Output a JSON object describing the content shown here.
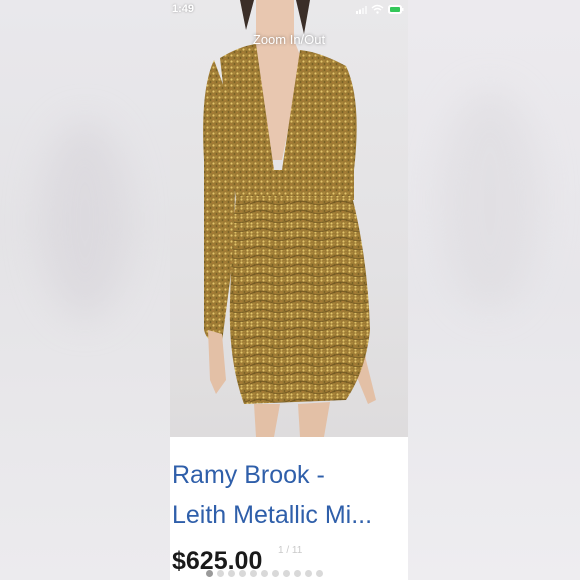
{
  "status_bar": {
    "time": "1:49"
  },
  "viewer": {
    "zoom_hint": "Zoom In/Out",
    "counter": "1 / 11"
  },
  "product": {
    "title_line_1": "Ramy Brook -",
    "title_line_2": "Leith Metallic Mi...",
    "price": "$625.00"
  },
  "colors": {
    "title": "#2f5faa",
    "price": "#1a1a1a",
    "dress_gold": "#a8833a",
    "background": "#e6e5e8"
  },
  "icons": [
    "signal-icon",
    "wifi-icon",
    "battery-icon"
  ]
}
